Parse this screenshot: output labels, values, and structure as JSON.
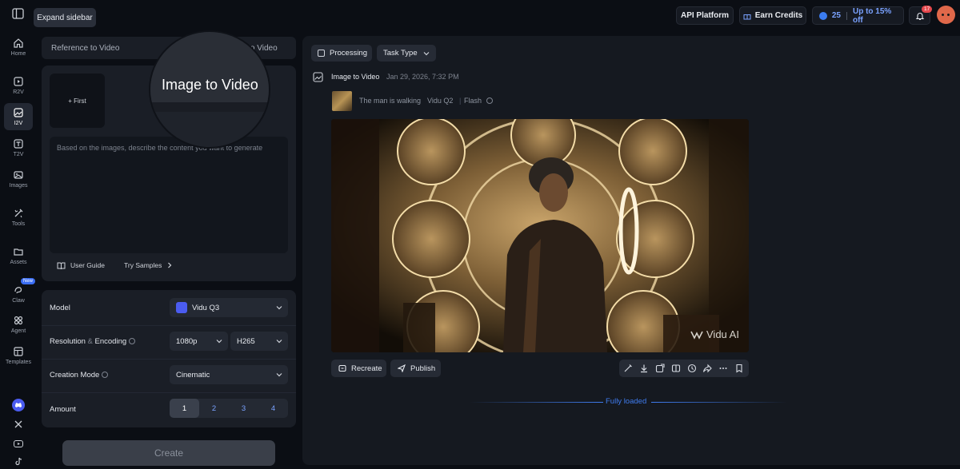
{
  "tooltip": "Expand sidebar",
  "nav": [
    {
      "label": "Home",
      "icon": "home-icon"
    },
    {
      "label": "R2V",
      "icon": "reference-video-icon"
    },
    {
      "label": "I2V",
      "icon": "image-video-icon"
    },
    {
      "label": "T2V",
      "icon": "text-video-icon"
    },
    {
      "label": "Images",
      "icon": "images-icon"
    },
    {
      "label": "Tools",
      "icon": "tools-icon"
    },
    {
      "label": "Assets",
      "icon": "folder-icon"
    },
    {
      "label": "Claw",
      "icon": "claw-icon",
      "badge": "New"
    },
    {
      "label": "Agent",
      "icon": "agent-icon"
    },
    {
      "label": "Templates",
      "icon": "templates-icon"
    }
  ],
  "topbar": {
    "api": "API Platform",
    "earn": "Earn Credits",
    "credits": "25",
    "promo": "Up to 15% off",
    "notifications": "17"
  },
  "tabs": {
    "reference": "Reference to Video",
    "image": "Image to Video",
    "text": "Text to Video"
  },
  "input": {
    "first": "+ First",
    "placeholder": "Based on the images, describe the content you want to generate",
    "guide": "User Guide",
    "samples": "Try Samples"
  },
  "settings": {
    "model_label": "Model",
    "model_value": "Vidu Q3",
    "resolution_label": "Resolution",
    "resolution_amp": "&",
    "encoding_label": "Encoding",
    "resolution_value": "1080p",
    "encoding_value": "H265",
    "mode_label": "Creation Mode",
    "mode_value": "Cinematic",
    "amount_label": "Amount",
    "amounts": [
      "1",
      "2",
      "3",
      "4"
    ]
  },
  "create": "Create",
  "right": {
    "processing": "Processing",
    "task_type": "Task Type",
    "task_title": "Image to Video",
    "task_date": "Jan 29, 2026, 7:32 PM",
    "prompt": "The man is walking",
    "model": "Vidu Q2",
    "speed": "Flash",
    "watermark": "Vidu AI",
    "recreate": "Recreate",
    "publish": "Publish",
    "fully_loaded": "Fully loaded"
  }
}
